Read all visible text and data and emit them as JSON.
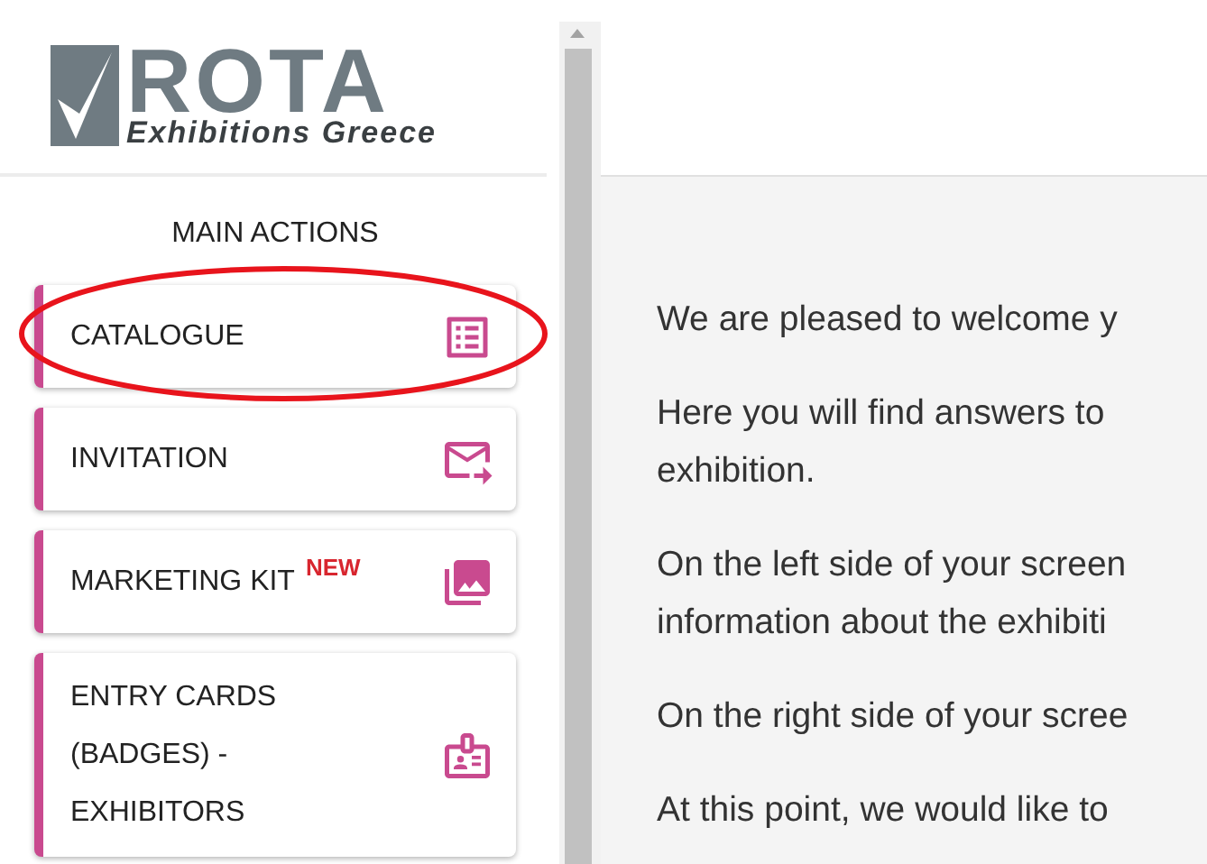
{
  "logo": {
    "wordmark": "ROTA",
    "tagline": "Exhibitions Greece"
  },
  "sidebar": {
    "heading": "MAIN ACTIONS",
    "items": [
      {
        "label": "CATALOGUE"
      },
      {
        "label": "INVITATION"
      },
      {
        "label": "MARKETING KIT",
        "badge": "NEW"
      },
      {
        "label": "ENTRY CARDS (BADGES) - EXHIBITORS"
      }
    ]
  },
  "main": {
    "paragraphs": [
      [
        "We are pleased to welcome y"
      ],
      [
        "Here you will find answers to",
        "exhibition."
      ],
      [
        "On the left side of your screen",
        "information about the exhibiti"
      ],
      [
        "On the right side of your scree"
      ],
      [
        "At this point, we would like to"
      ]
    ]
  }
}
